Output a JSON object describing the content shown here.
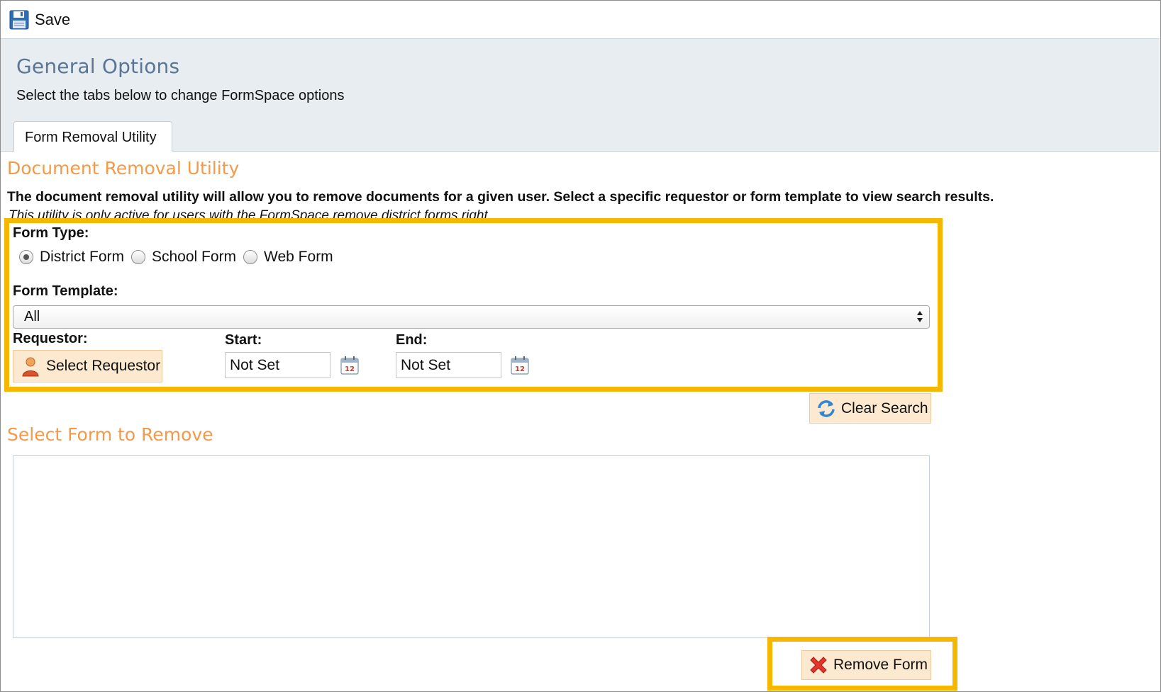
{
  "toolbar": {
    "save_label": "Save",
    "save_icon": "floppy-disk-icon"
  },
  "header": {
    "title": "General Options",
    "subtitle": "Select the tabs below to change FormSpace options",
    "tabs": [
      {
        "label": "Form Removal Utility"
      }
    ]
  },
  "utility": {
    "title": "Document Removal Utility",
    "description": "The document removal utility will allow you to remove documents for a given user. Select a specific requestor or form template to view search results.",
    "note": "This utility is only active for users with the FormSpace remove district forms right"
  },
  "filters": {
    "form_type_label": "Form Type:",
    "form_types": [
      {
        "label": "District Form",
        "checked": true
      },
      {
        "label": "School Form",
        "checked": false
      },
      {
        "label": "Web Form",
        "checked": false
      }
    ],
    "form_template_label": "Form Template:",
    "form_template_value": "All",
    "requestor_label": "Requestor:",
    "select_requestor_label": "Select Requestor",
    "start_label": "Start:",
    "start_value": "Not Set",
    "end_label": "End:",
    "end_value": "Not Set",
    "calendar_day": "12"
  },
  "actions": {
    "clear_search_label": "Clear Search",
    "remove_form_label": "Remove Form"
  },
  "results": {
    "title": "Select Form to Remove",
    "items": []
  },
  "colors": {
    "accent_orange": "#f39a4a",
    "title_blue": "#5b7594",
    "highlight": "#f5b700",
    "button_bg": "#fce9cf",
    "header_bg": "#e8edf2"
  }
}
